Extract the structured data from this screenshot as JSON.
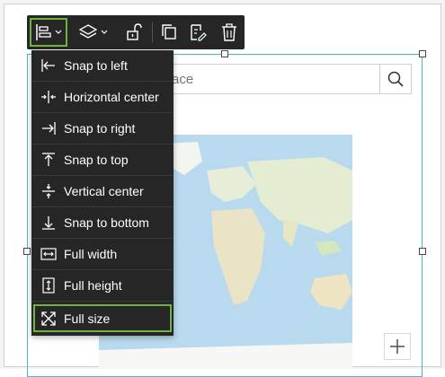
{
  "toolbar": {
    "buttons": [
      {
        "name": "align-button",
        "icon": "align-left-icon",
        "has_dropdown": true,
        "active": true
      },
      {
        "name": "arrange-button",
        "icon": "layers-icon",
        "has_dropdown": true,
        "active": false
      },
      {
        "name": "lock-button",
        "icon": "unlock-icon",
        "has_dropdown": false,
        "active": false
      },
      {
        "name": "duplicate-button",
        "icon": "copy-icon",
        "has_dropdown": false,
        "active": false
      },
      {
        "name": "copy-style-button",
        "icon": "paste-style-icon",
        "has_dropdown": false,
        "active": false
      },
      {
        "name": "delete-button",
        "icon": "trash-icon",
        "has_dropdown": false,
        "active": false
      }
    ]
  },
  "align_menu": {
    "items": [
      {
        "label": "Snap to left",
        "icon": "snap-left-icon"
      },
      {
        "label": "Horizontal center",
        "icon": "horizontal-center-icon"
      },
      {
        "label": "Snap to right",
        "icon": "snap-right-icon"
      },
      {
        "label": "Snap to top",
        "icon": "snap-top-icon"
      },
      {
        "label": "Vertical center",
        "icon": "vertical-center-icon"
      },
      {
        "label": "Snap to bottom",
        "icon": "snap-bottom-icon"
      },
      {
        "label": "Full width",
        "icon": "full-width-icon"
      },
      {
        "label": "Full height",
        "icon": "full-height-icon"
      },
      {
        "label": "Full size",
        "icon": "full-size-icon"
      }
    ],
    "selected": "Full size"
  },
  "search": {
    "placeholder": "ace"
  },
  "colors": {
    "toolbar_bg": "#262626",
    "highlight": "#6eb53f",
    "selection_border": "#4bb7c4"
  }
}
